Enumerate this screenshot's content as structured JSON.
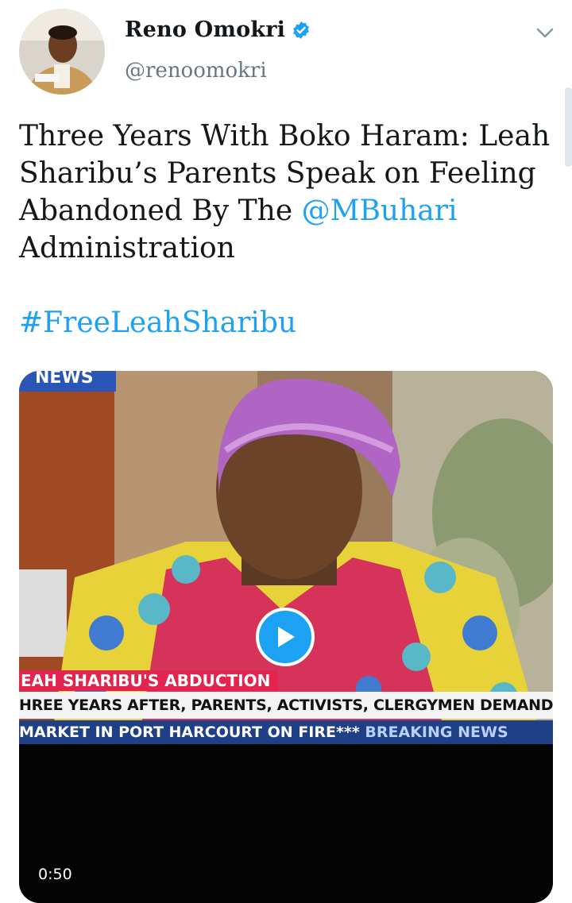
{
  "author": {
    "name": "Reno Omokri",
    "handle": "@renoomokri",
    "verified_icon": "verified-badge-icon"
  },
  "tweet": {
    "text_part1": "Three Years With Boko Haram: Leah Sharibu’s Parents Speak on Feeling Abandoned By The ",
    "mention": "@MBuhari",
    "text_part2": " Administration",
    "hashtag": "#FreeLeahSharibu"
  },
  "media": {
    "duration": "0:50",
    "news_tag": "NEWS",
    "ticker_headline": "EAH SHARIBU'S ABDUCTION",
    "ticker_sub": "HREE YEARS AFTER, PARENTS, ACTIVISTS, CLERGYMEN DEMAND FOR HER RES",
    "ticker_bottom": "MARKET IN PORT HARCOURT ON FIRE***",
    "ticker_bottom_tag": "BREAKING NEWS"
  },
  "colors": {
    "link": "#1da1f2",
    "text": "#14171a",
    "secondary": "#657786"
  }
}
